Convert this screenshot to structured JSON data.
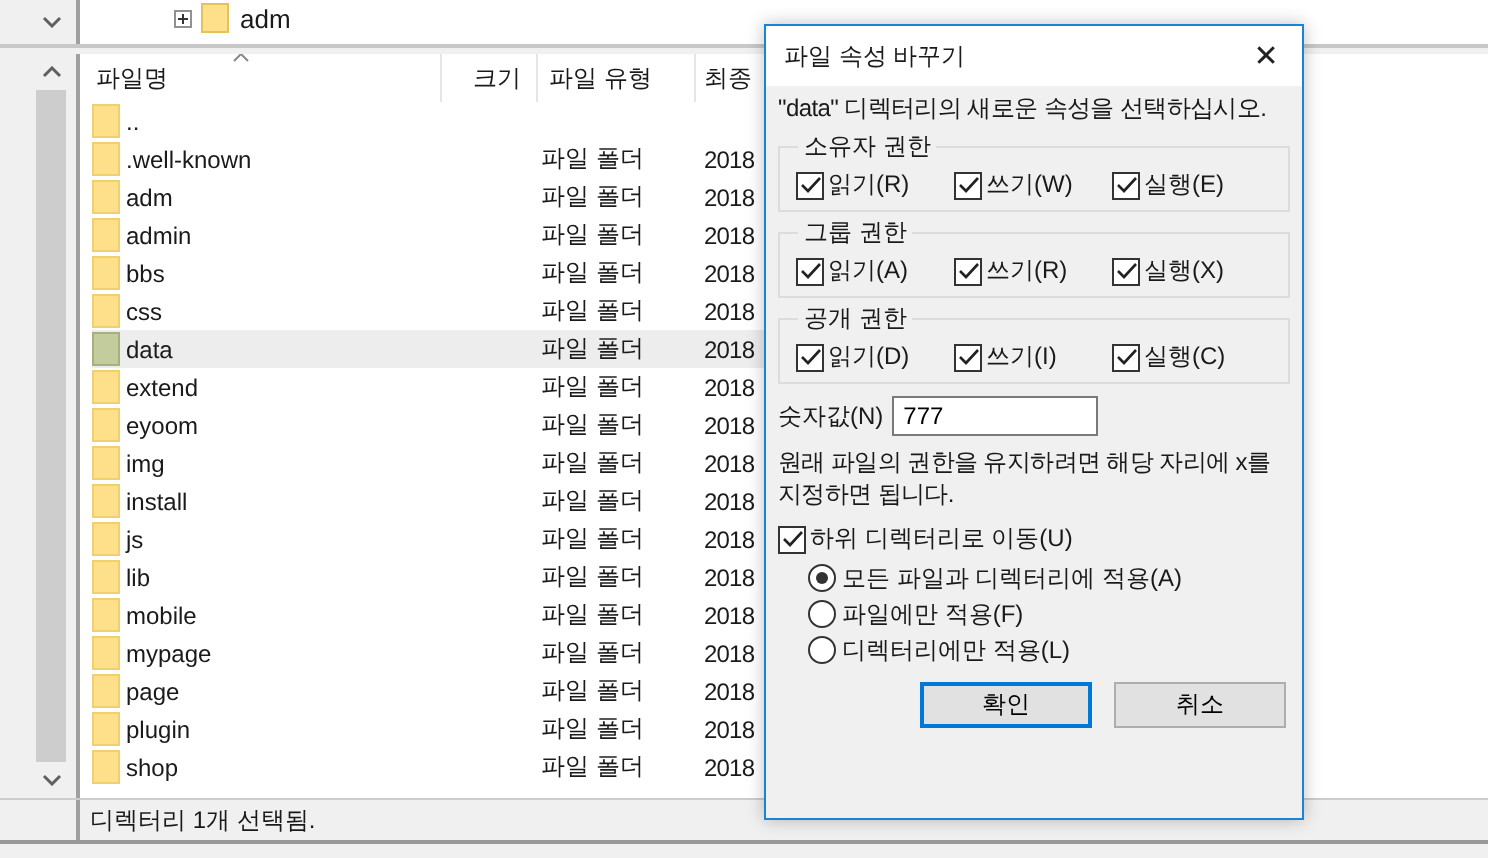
{
  "tree": {
    "node": {
      "label": "adm",
      "expanded": false
    }
  },
  "file_list": {
    "columns": [
      "파일명",
      "크기",
      "파일 유형",
      "최종"
    ],
    "rows": [
      {
        "name": "..",
        "selected": false
      },
      {
        "name": ".well-known",
        "type": "파일 폴더",
        "date": "2018",
        "selected": false
      },
      {
        "name": "adm",
        "type": "파일 폴더",
        "date": "2018",
        "selected": false
      },
      {
        "name": "admin",
        "type": "파일 폴더",
        "date": "2018",
        "selected": false
      },
      {
        "name": "bbs",
        "type": "파일 폴더",
        "date": "2018",
        "selected": false
      },
      {
        "name": "css",
        "type": "파일 폴더",
        "date": "2018",
        "selected": false
      },
      {
        "name": "data",
        "type": "파일 폴더",
        "date": "2018",
        "selected": true
      },
      {
        "name": "extend",
        "type": "파일 폴더",
        "date": "2018",
        "selected": false
      },
      {
        "name": "eyoom",
        "type": "파일 폴더",
        "date": "2018",
        "selected": false
      },
      {
        "name": "img",
        "type": "파일 폴더",
        "date": "2018",
        "selected": false
      },
      {
        "name": "install",
        "type": "파일 폴더",
        "date": "2018",
        "selected": false
      },
      {
        "name": "js",
        "type": "파일 폴더",
        "date": "2018",
        "selected": false
      },
      {
        "name": "lib",
        "type": "파일 폴더",
        "date": "2018",
        "selected": false
      },
      {
        "name": "mobile",
        "type": "파일 폴더",
        "date": "2018",
        "selected": false
      },
      {
        "name": "mypage",
        "type": "파일 폴더",
        "date": "2018",
        "selected": false
      },
      {
        "name": "page",
        "type": "파일 폴더",
        "date": "2018",
        "selected": false
      },
      {
        "name": "plugin",
        "type": "파일 폴더",
        "date": "2018",
        "selected": false
      },
      {
        "name": "shop",
        "type": "파일 폴더",
        "date": "2018",
        "selected": false
      }
    ]
  },
  "status_bar": "디렉터리 1개 선택됨.",
  "dialog": {
    "title": "파일 속성 바꾸기",
    "close": "✕",
    "prompt": "\"data\" 디렉터리의 새로운 속성을 선택하십시오.",
    "groups": [
      {
        "title": "소유자 권한",
        "options": [
          {
            "label": "읽기(R)",
            "checked": true
          },
          {
            "label": "쓰기(W)",
            "checked": true
          },
          {
            "label": "실행(E)",
            "checked": true
          }
        ]
      },
      {
        "title": "그룹 권한",
        "options": [
          {
            "label": "읽기(A)",
            "checked": true
          },
          {
            "label": "쓰기(R)",
            "checked": true
          },
          {
            "label": "실행(X)",
            "checked": true
          }
        ]
      },
      {
        "title": "공개 권한",
        "options": [
          {
            "label": "읽기(D)",
            "checked": true
          },
          {
            "label": "쓰기(I)",
            "checked": true
          },
          {
            "label": "실행(C)",
            "checked": true
          }
        ]
      }
    ],
    "numeric": {
      "label": "숫자값(N)",
      "value": "777"
    },
    "note": "원래 파일의 권한을 유지하려면 해당 자리에 x를 지정하면 됩니다.",
    "recurse": {
      "label": "하위 디렉터리로 이동(U)",
      "checked": true
    },
    "apply_options": [
      {
        "label": "모든 파일과 디렉터리에 적용(A)",
        "selected": true
      },
      {
        "label": "파일에만 적용(F)",
        "selected": false
      },
      {
        "label": "디렉터리에만 적용(L)",
        "selected": false
      }
    ],
    "buttons": [
      {
        "label": "확인",
        "default": true
      },
      {
        "label": "취소",
        "default": false
      }
    ]
  }
}
